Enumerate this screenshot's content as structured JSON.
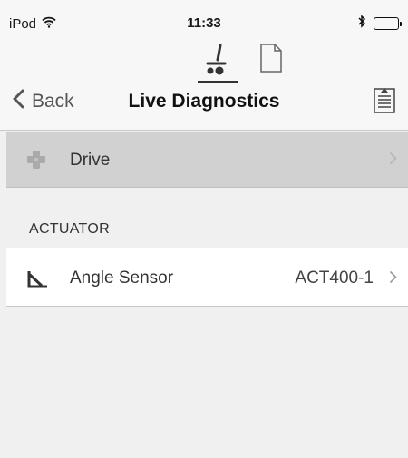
{
  "status_bar": {
    "carrier": "iPod",
    "time": "11:33",
    "icons": [
      "wifi-icon",
      "bluetooth-icon",
      "battery-icon"
    ]
  },
  "nav_bar": {
    "segments": [
      {
        "icon": "wheelchair-icon",
        "selected": true
      },
      {
        "icon": "document-icon",
        "selected": false
      }
    ],
    "back_label": "Back",
    "title": "Live Diagnostics",
    "action_icon": "share-icon"
  },
  "list": {
    "drive": {
      "label": "Drive",
      "icon": "dpad-icon",
      "disabled": true
    },
    "sections": [
      {
        "header": "ACTUATOR",
        "rows": [
          {
            "label": "Angle Sensor",
            "value": "ACT400-1",
            "icon": "angle-icon"
          }
        ]
      }
    ]
  },
  "colors": {
    "background": "#f0f0f0",
    "disabled_row": "#d1d1d1",
    "row": "#ffffff",
    "text": "#333333"
  }
}
